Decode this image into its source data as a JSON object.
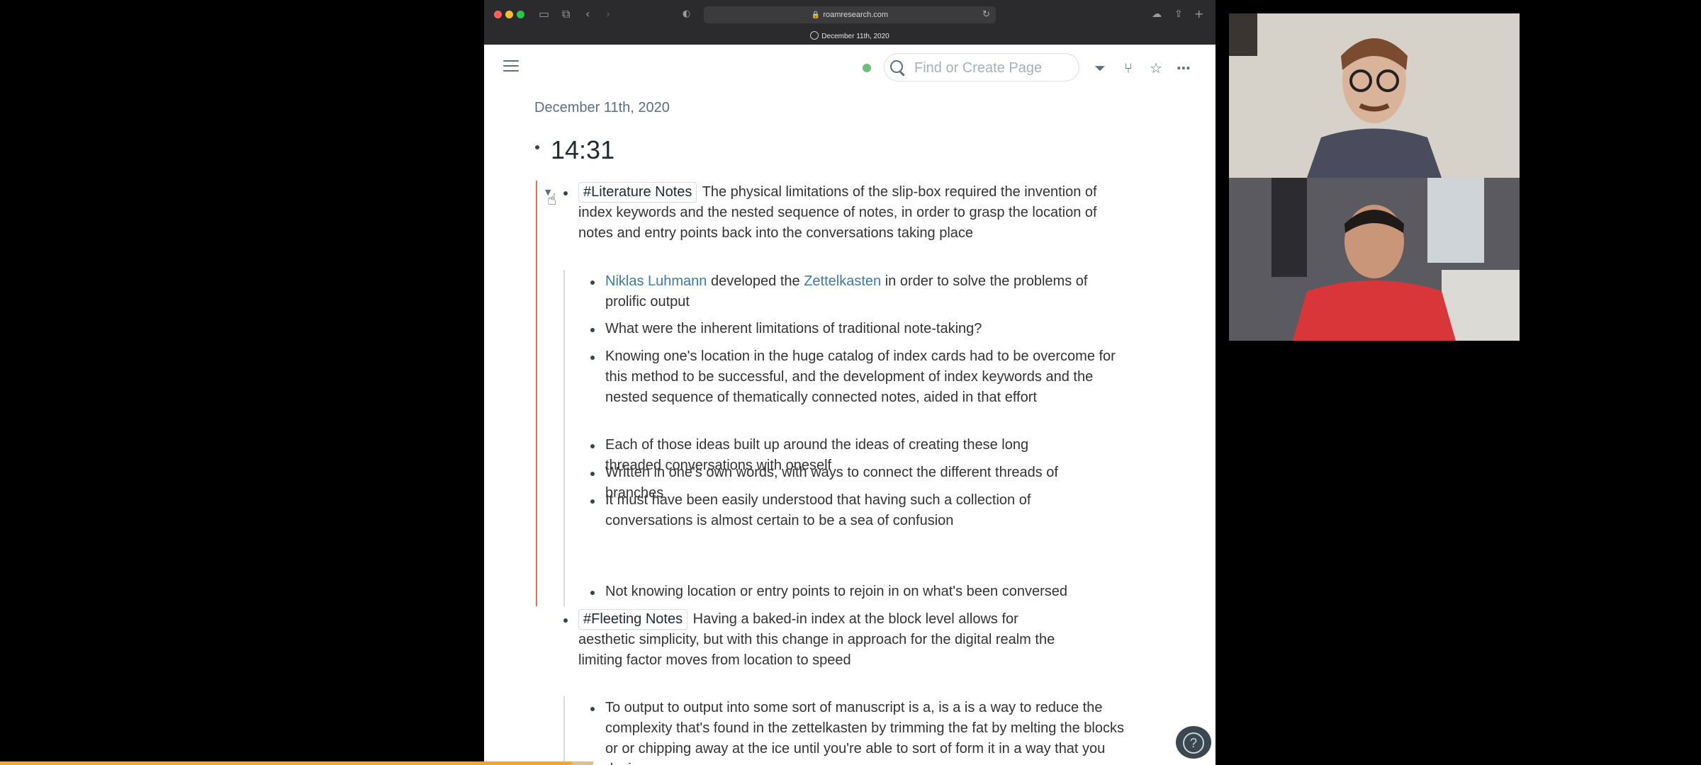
{
  "browser": {
    "url": "roamresearch.com",
    "tab_title": "December 11th, 2020",
    "toolbar_icons": [
      "sidebar-icon",
      "tabs-icon",
      "back-icon",
      "forward-icon",
      "shield-icon",
      "reload-icon",
      "cloud-icon",
      "share-icon",
      "new-tab-icon"
    ]
  },
  "roam": {
    "search_placeholder": "Find or Create Page",
    "sync_color": "#6cbf78",
    "toolbar": [
      "filter-icon",
      "graph-icon",
      "star-icon",
      "more-icon"
    ],
    "page_title": "December 11th, 2020",
    "time_heading": "14:31",
    "blocks": {
      "lit": {
        "tag": "#Literature Notes",
        "text": "The physical limitations of the slip-box required the invention of index keywords and the nested sequence of notes, in order to grasp the location of notes and entry points back into the conversations taking place",
        "child1_link1": "Niklas Luhmann",
        "child1_mid": "developed the",
        "child1_link2": "Zettelkasten",
        "child1_end": "in order to solve the problems of prolific output",
        "child2": "What were the inherent limitations of traditional note-taking?",
        "child3": "Knowing one's location in the huge catalog of index cards had to be overcome for this method to be successful, and the development of index keywords and the nested sequence of thematically connected notes, aided in that effort",
        "child4": "Each of those ideas built up around the ideas of creating these long threaded conversations with oneself",
        "child5": "Written in one's own words, with ways to connect the different threads of branches",
        "child6": "It must have been easily understood that having such a collection of conversations is almost certain to be a sea of confusion",
        "child7": "Not knowing location or entry points to rejoin in on what's been conversed"
      },
      "fleeting": {
        "tag": "#Fleeting Notes",
        "text": "Having a baked-in index at the block level allows for aesthetic simplicity, but with this change in approach for the digital realm the limiting factor moves from location to speed",
        "child1": "To output to output into some sort of manuscript is a, is a is a way to reduce the complexity that's found in the zettelkasten by trimming the fat by melting the blocks or or chipping away at the ice until you're able to sort of form it in a way that you desire."
      }
    },
    "help_label": "?"
  },
  "video": {
    "progress_color": "#f5a623"
  }
}
